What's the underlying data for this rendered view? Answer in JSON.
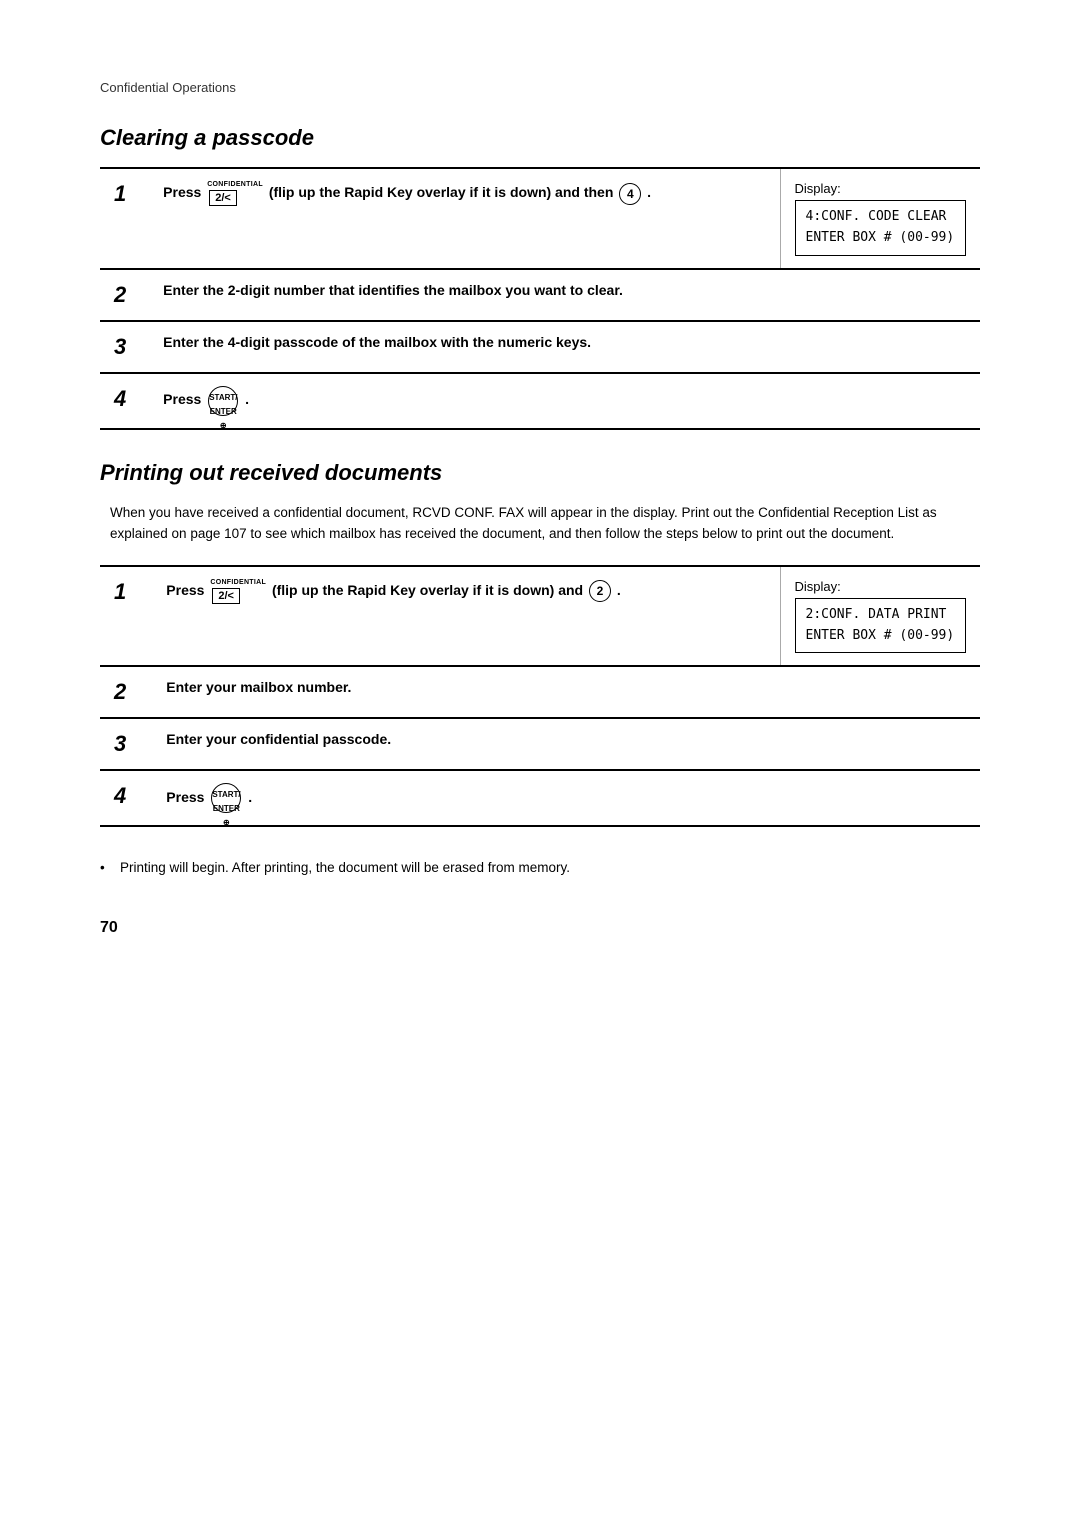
{
  "page": {
    "section_label": "Confidential Operations",
    "page_number": "70"
  },
  "clearing_passcode": {
    "title": "Clearing a passcode",
    "steps": [
      {
        "num": "1",
        "text_before": "Press",
        "key_label": "CONFIDENTIAL",
        "key_text": "2/<",
        "text_middle": "(flip up the Rapid Key overlay if it is down) and then",
        "circle_num": "4",
        "text_after": ".",
        "has_display": true,
        "display_label": "Display:",
        "display_line1": "4:CONF. CODE CLEAR",
        "display_line2": "ENTER BOX # (00-99)"
      },
      {
        "num": "2",
        "text": "Enter the 2-digit number that identifies the mailbox you want to clear.",
        "has_display": false
      },
      {
        "num": "3",
        "text": "Enter the 4-digit passcode of the mailbox with the numeric keys.",
        "has_display": false
      },
      {
        "num": "4",
        "text_before": "Press",
        "key_text": "START/\nENTER",
        "text_after": ".",
        "has_display": false
      }
    ]
  },
  "printing_docs": {
    "title": "Printing out received documents",
    "description": "When you have received a confidential document, RCVD CONF. FAX will appear in the display. Print out the Confidential Reception List as explained on page 107 to see which mailbox has received the document, and then follow the steps below to print out the document.",
    "steps": [
      {
        "num": "1",
        "text_before": "Press",
        "key_label": "CONFIDENTIAL",
        "key_text": "2/<",
        "text_middle": "(flip up the Rapid Key overlay if it is down) and",
        "circle_num": "2",
        "text_after": ".",
        "has_display": true,
        "display_label": "Display:",
        "display_line1": "2:CONF. DATA PRINT",
        "display_line2": "ENTER BOX # (00-99)"
      },
      {
        "num": "2",
        "text": "Enter your mailbox number.",
        "has_display": false
      },
      {
        "num": "3",
        "text": "Enter your confidential passcode.",
        "has_display": false
      },
      {
        "num": "4",
        "text_before": "Press",
        "key_text": "START/\nENTER",
        "text_after": ".",
        "has_display": false
      }
    ],
    "bullet": "Printing will begin. After printing, the document will be erased from memory."
  }
}
